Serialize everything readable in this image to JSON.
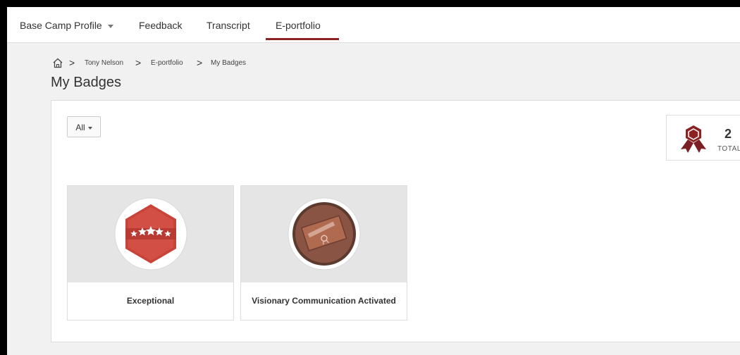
{
  "nav": {
    "items": [
      {
        "label": "Base Camp Profile",
        "has_dropdown": true
      },
      {
        "label": "Feedback"
      },
      {
        "label": "Transcript"
      },
      {
        "label": "E-portfolio",
        "active": true
      }
    ],
    "accent_color": "#8b2323"
  },
  "breadcrumb": {
    "home_icon": "home-icon",
    "items": [
      "Tony Nelson",
      "E-portfolio",
      "My Badges"
    ],
    "separator": ">"
  },
  "page_title": "My Badges",
  "filter": {
    "selected": "All"
  },
  "total": {
    "count": "2",
    "label": "TOTAL",
    "icon": "award-ribbon-icon"
  },
  "badges": [
    {
      "name": "Exceptional",
      "icon": "five-stars-hexagon-icon",
      "color": "#c8433a"
    },
    {
      "name": "Visionary Communication Activated",
      "icon": "telescope-circle-icon",
      "color": "#7a4a3a"
    }
  ]
}
